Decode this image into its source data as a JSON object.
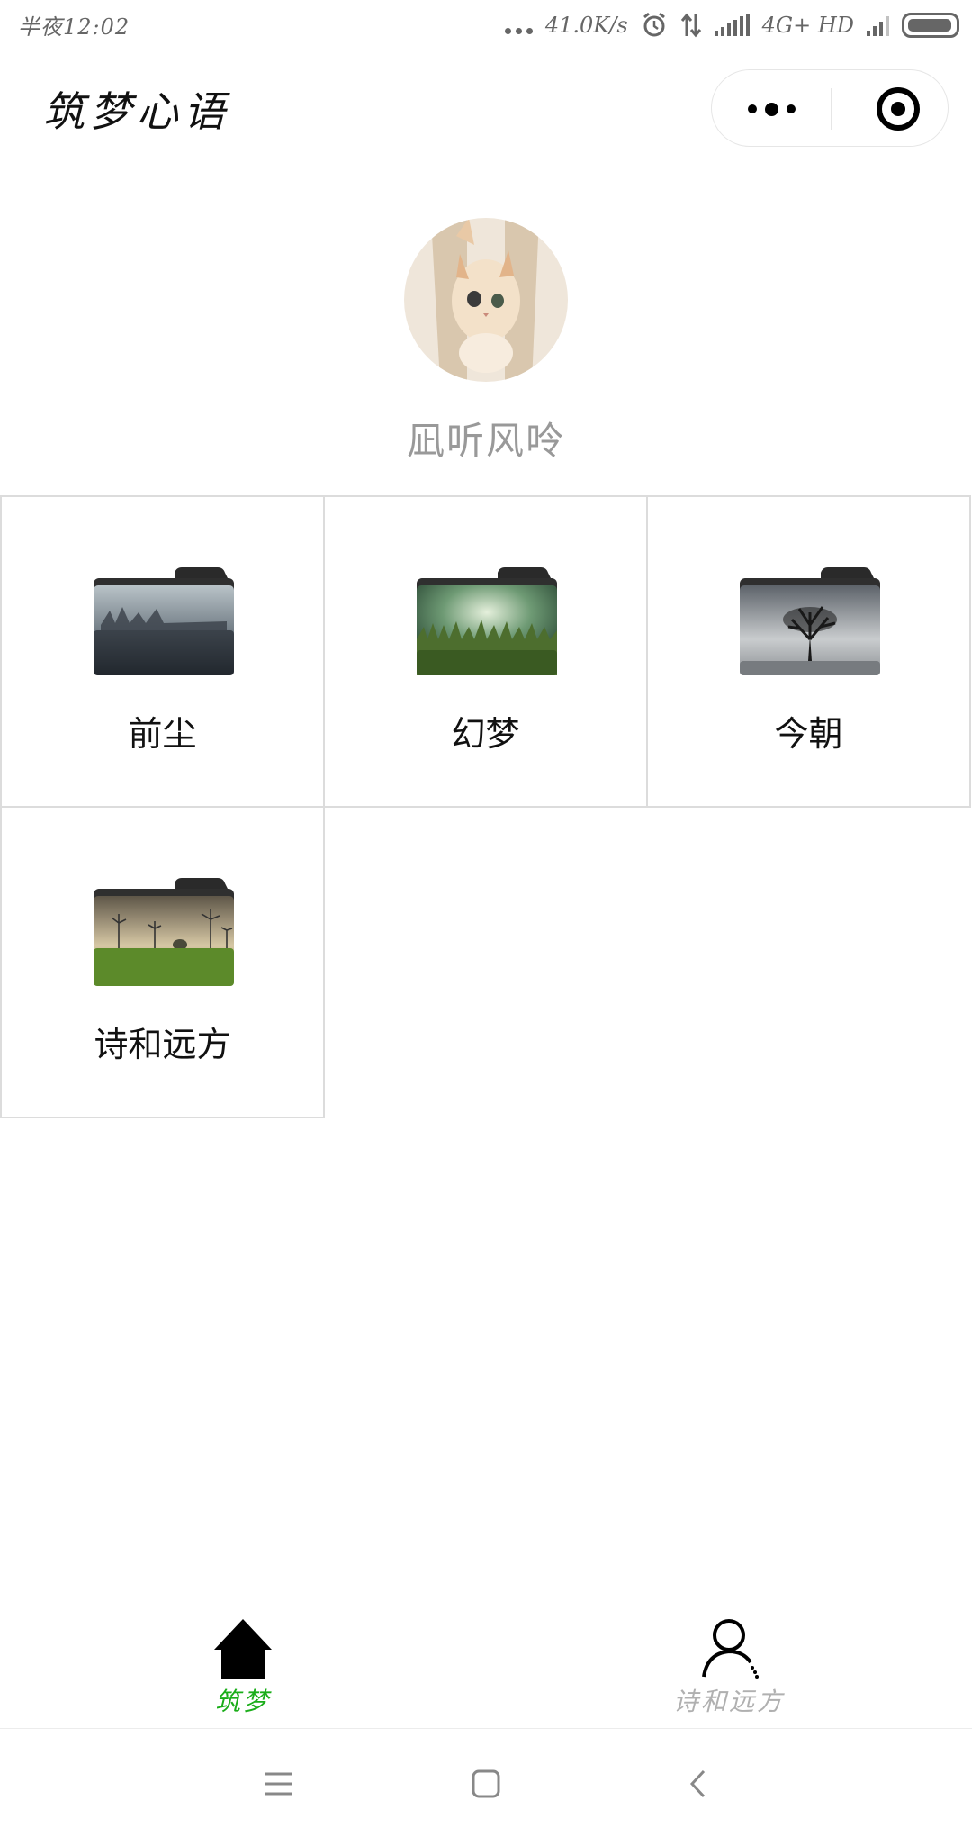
{
  "status_bar": {
    "time": "半夜12:02",
    "speed": "41.0K/s",
    "network": "4G+ HD"
  },
  "header": {
    "title": "筑梦心语",
    "more_icon": "more-dots-icon",
    "close_icon": "target-circle-icon"
  },
  "profile": {
    "username": "凪听风呤",
    "avatar_desc_icon": "kitten-avatar"
  },
  "folders": [
    {
      "label": "前尘",
      "icon": "folder-misty-lake-icon"
    },
    {
      "label": "幻梦",
      "icon": "folder-green-field-icon"
    },
    {
      "label": "今朝",
      "icon": "folder-lone-tree-icon"
    },
    {
      "label": "诗和远方",
      "icon": "folder-wind-turbines-icon"
    }
  ],
  "tabbar": {
    "items": [
      {
        "label": "筑梦",
        "icon": "home-icon",
        "active": true,
        "color": "#1aad19"
      },
      {
        "label": "诗和远方",
        "icon": "user-icon",
        "active": false,
        "color": "#b0b0b0"
      }
    ]
  },
  "colors": {
    "accent": "#1aad19",
    "border": "#dcdcdc",
    "muted_text": "#999999"
  }
}
